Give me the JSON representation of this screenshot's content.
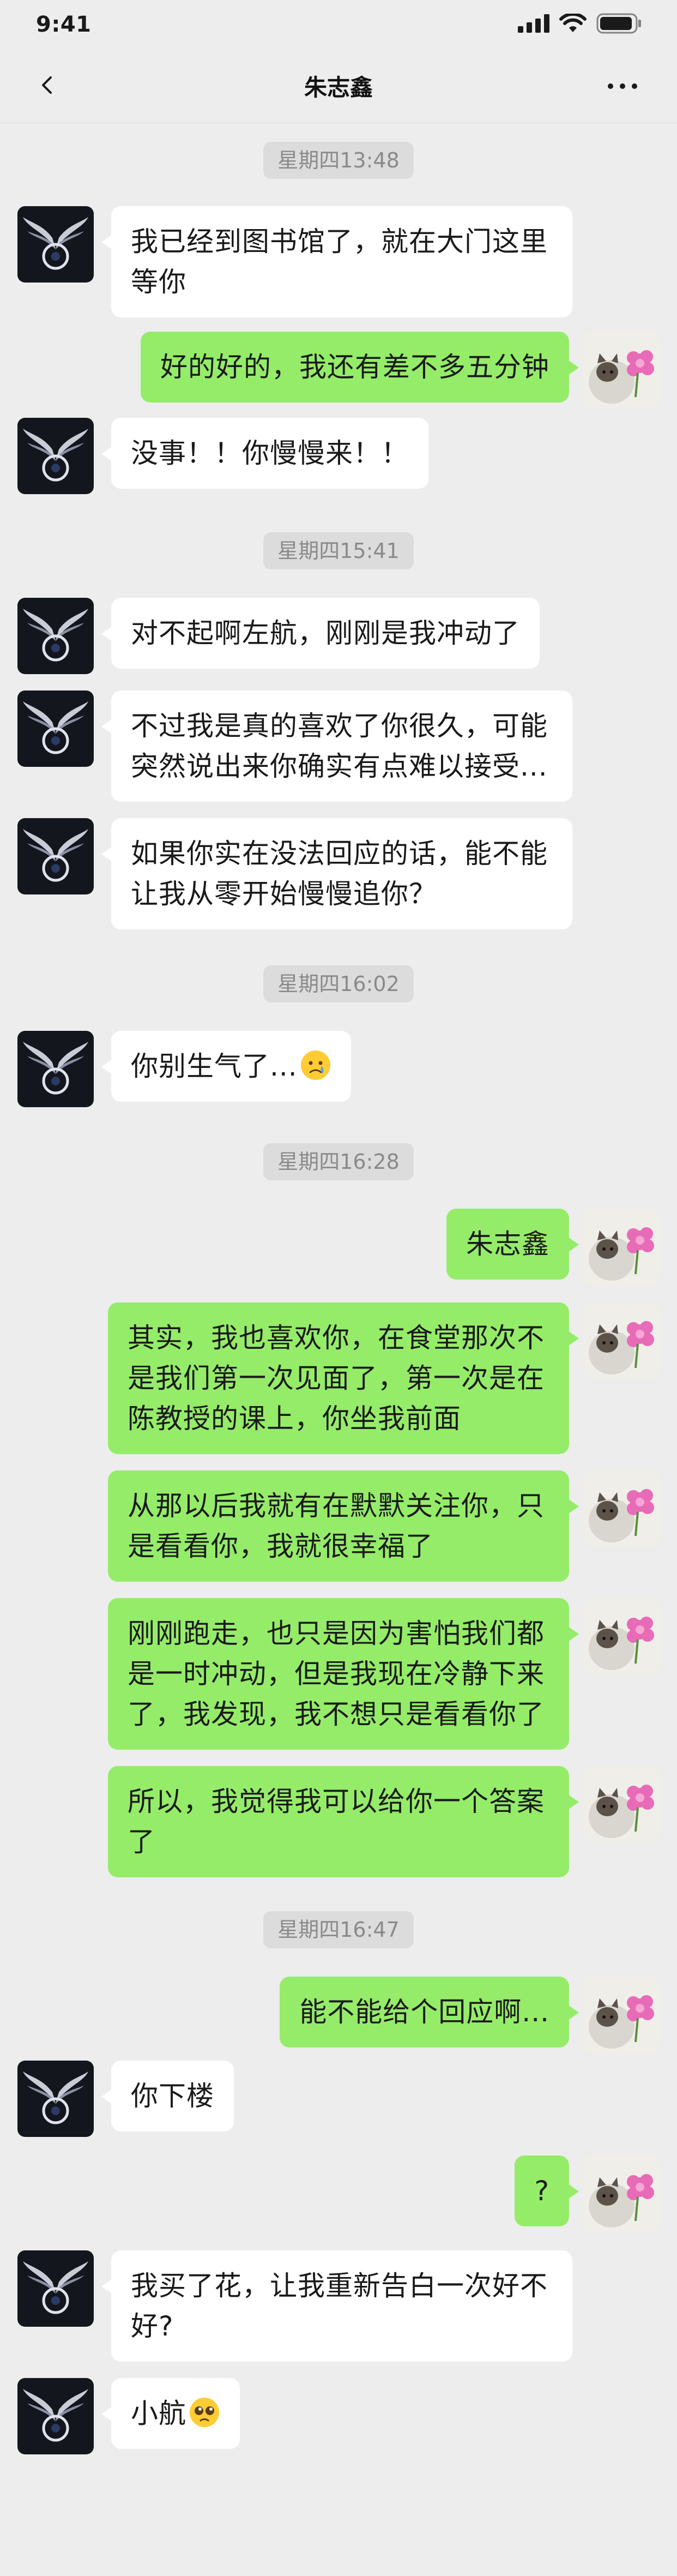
{
  "status_bar": {
    "time": "9:41"
  },
  "header": {
    "title": "朱志鑫"
  },
  "colors": {
    "background": "#ededed",
    "sent_bubble": "#95ec69",
    "received_bubble": "#ffffff",
    "timestamp_pill": "#dcdcdc"
  },
  "messages": [
    {
      "type": "time",
      "text": "星期四13:48"
    },
    {
      "type": "received",
      "text": "我已经到图书馆了，就在大门这里等你"
    },
    {
      "type": "sent",
      "text": "好的好的，我还有差不多五分钟"
    },
    {
      "type": "received",
      "text": "没事！！你慢慢来！！"
    },
    {
      "type": "time",
      "text": "星期四15:41"
    },
    {
      "type": "received",
      "text": "对不起啊左航，刚刚是我冲动了"
    },
    {
      "type": "received",
      "text": "不过我是真的喜欢了你很久，可能突然说出来你确实有点难以接受..."
    },
    {
      "type": "received",
      "text": "如果你实在没法回应的话，能不能让我从零开始慢慢追你？"
    },
    {
      "type": "time",
      "text": "星期四16:02"
    },
    {
      "type": "received",
      "text": "你别生气了...",
      "emoji": "crying-face-emoji"
    },
    {
      "type": "time",
      "text": "星期四16:28"
    },
    {
      "type": "sent",
      "text": "朱志鑫"
    },
    {
      "type": "sent",
      "text": "其实，我也喜欢你，在食堂那次不是我们第一次见面了，第一次是在陈教授的课上，你坐我前面"
    },
    {
      "type": "sent",
      "text": "从那以后我就有在默默关注你，只是看看你，我就很幸福了"
    },
    {
      "type": "sent",
      "text": "刚刚跑走，也只是因为害怕我们都是一时冲动，但是我现在冷静下来了，我发现，我不想只是看看你了"
    },
    {
      "type": "sent",
      "text": "所以，我觉得我可以给你一个答案了"
    },
    {
      "type": "time",
      "text": "星期四16:47"
    },
    {
      "type": "sent",
      "text": "能不能给个回应啊..."
    },
    {
      "type": "received",
      "text": "你下楼"
    },
    {
      "type": "sent",
      "text": "?"
    },
    {
      "type": "received",
      "text": "我买了花，让我重新告白一次好不好?"
    },
    {
      "type": "received",
      "text": "小航",
      "emoji": "pleading-face-emoji"
    }
  ]
}
